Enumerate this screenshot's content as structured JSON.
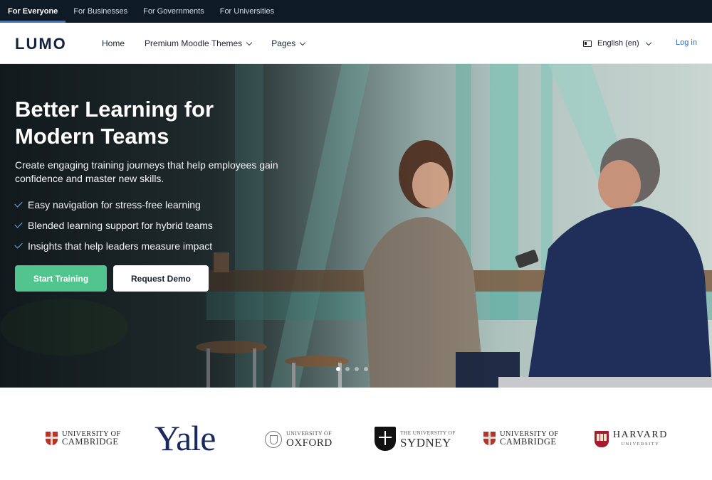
{
  "topbar": {
    "audiences": [
      {
        "label": "For Everyone",
        "active": true
      },
      {
        "label": "For Businesses",
        "active": false
      },
      {
        "label": "For Governments",
        "active": false
      },
      {
        "label": "For Universities",
        "active": false
      }
    ]
  },
  "nav": {
    "logo": "LUMO",
    "links": [
      {
        "label": "Home",
        "dropdown": false
      },
      {
        "label": "Premium Moodle Themes",
        "dropdown": true
      },
      {
        "label": "Pages",
        "dropdown": true
      }
    ],
    "language": "English (en)",
    "login": "Log in"
  },
  "hero": {
    "title": "Better Learning for Modern Teams",
    "subtitle": "Create engaging training journeys that help employees gain confidence and master new skills.",
    "features": [
      "Easy navigation for stress-free learning",
      "Blended learning support for hybrid teams",
      "Insights that help leaders measure impact"
    ],
    "primary_button": "Start Training",
    "secondary_button": "Request Demo",
    "slides": 4,
    "active_slide": 1
  },
  "logos": {
    "cambridge_1": {
      "line1": "UNIVERSITY OF",
      "line2": "CAMBRIDGE"
    },
    "yale": "Yale",
    "oxford": {
      "line1": "UNIVERSITY OF",
      "line2": "OXFORD"
    },
    "sydney": {
      "line1": "THE UNIVERSITY OF",
      "line2": "SYDNEY"
    },
    "cambridge_2": {
      "line1": "UNIVERSITY OF",
      "line2": "CAMBRIDGE"
    },
    "harvard": {
      "line1": "HARVARD",
      "line2": "UNIVERSITY"
    }
  },
  "colors": {
    "topbar_bg": "#0f1a27",
    "accent_blue": "#3b78c4",
    "primary_green": "#52c48e",
    "link_blue": "#2d6cc0"
  }
}
